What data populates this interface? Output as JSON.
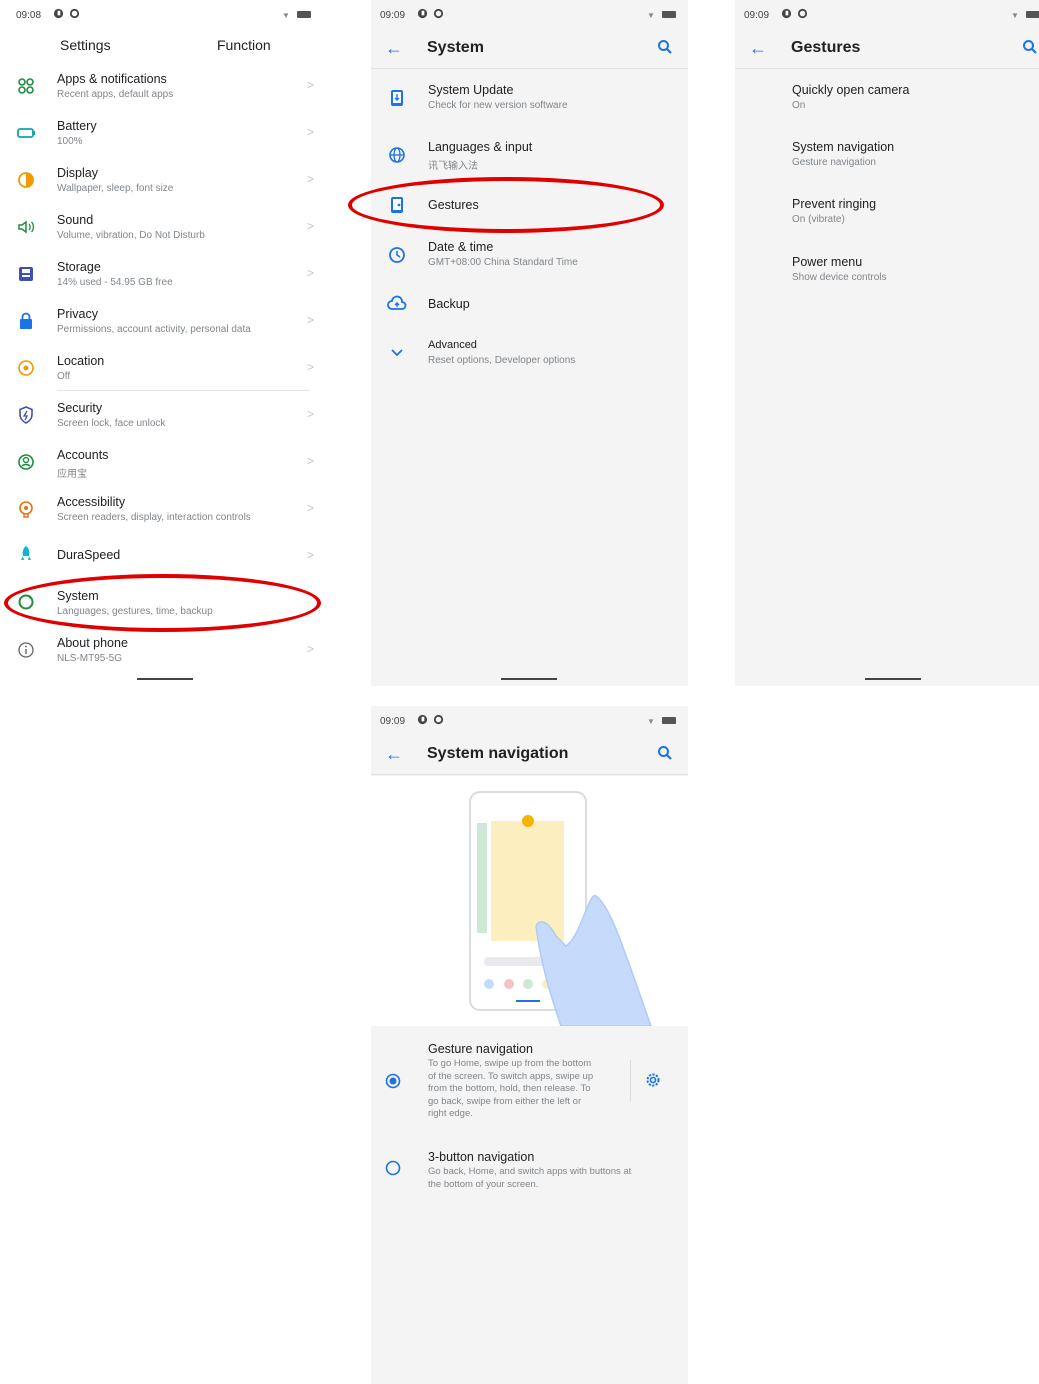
{
  "screen1": {
    "time": "09:08",
    "header": {
      "left": "Settings",
      "right": "Function"
    },
    "items": [
      {
        "title": "Apps & notifications",
        "subtitle": "Recent apps, default apps",
        "icon": "apps-icon"
      },
      {
        "title": "Battery",
        "subtitle": "100%",
        "icon": "battery-icon"
      },
      {
        "title": "Display",
        "subtitle": "Wallpaper, sleep, font size",
        "icon": "display-icon"
      },
      {
        "title": "Sound",
        "subtitle": "Volume, vibration, Do Not Disturb",
        "icon": "sound-icon"
      },
      {
        "title": "Storage",
        "subtitle": "14% used - 54.95 GB free",
        "icon": "storage-icon"
      },
      {
        "title": "Privacy",
        "subtitle": "Permissions, account activity, personal data",
        "icon": "privacy-icon"
      },
      {
        "title": "Location",
        "subtitle": "Off",
        "icon": "location-icon"
      },
      {
        "title": "Security",
        "subtitle": "Screen lock, face unlock",
        "icon": "security-icon"
      },
      {
        "title": "Accounts",
        "subtitle": "应用宝",
        "icon": "accounts-icon"
      },
      {
        "title": "Accessibility",
        "subtitle": "Screen readers, display, interaction controls",
        "icon": "accessibility-icon"
      },
      {
        "title": "DuraSpeed",
        "subtitle": "",
        "icon": "duraspeed-icon"
      },
      {
        "title": "System",
        "subtitle": "Languages, gestures, time, backup",
        "icon": "system-icon"
      },
      {
        "title": "About phone",
        "subtitle": "NLS-MT95-5G",
        "icon": "info-icon"
      }
    ]
  },
  "screen2": {
    "time": "09:09",
    "title": "System",
    "items": [
      {
        "title": "System Update",
        "subtitle": "Check for new version software",
        "icon": "system-update-icon"
      },
      {
        "title": "Languages & input",
        "subtitle": "讯飞输入法",
        "icon": "globe-icon"
      },
      {
        "title": "Gestures",
        "subtitle": "",
        "icon": "gestures-icon"
      },
      {
        "title": "Date & time",
        "subtitle": "GMT+08:00 China Standard Time",
        "icon": "clock-icon"
      },
      {
        "title": "Backup",
        "subtitle": "",
        "icon": "backup-icon"
      },
      {
        "title": "Advanced",
        "subtitle": "Reset options, Developer options",
        "icon": "chevron-down-icon"
      }
    ]
  },
  "screen3": {
    "time": "09:09",
    "title": "Gestures",
    "items": [
      {
        "title": "Quickly open camera",
        "subtitle": "On"
      },
      {
        "title": "System navigation",
        "subtitle": "Gesture navigation"
      },
      {
        "title": "Prevent ringing",
        "subtitle": "On (vibrate)"
      },
      {
        "title": "Power menu",
        "subtitle": "Show device controls"
      }
    ]
  },
  "screen4": {
    "time": "09:09",
    "title": "System navigation",
    "options": [
      {
        "title": "Gesture navigation",
        "lines": [
          "To go Home, swipe up from the bottom",
          "of the screen. To switch apps, swipe up",
          "from the bottom, hold, then release. To",
          "go back, swipe from either the left or",
          "right edge."
        ],
        "selected": true
      },
      {
        "title": "3-button navigation",
        "lines": [
          "Go back, Home, and switch apps with buttons at",
          "the bottom of your screen."
        ],
        "selected": false
      }
    ]
  },
  "colors": {
    "accent": "#1a73e8",
    "highlight": "#e00000"
  }
}
